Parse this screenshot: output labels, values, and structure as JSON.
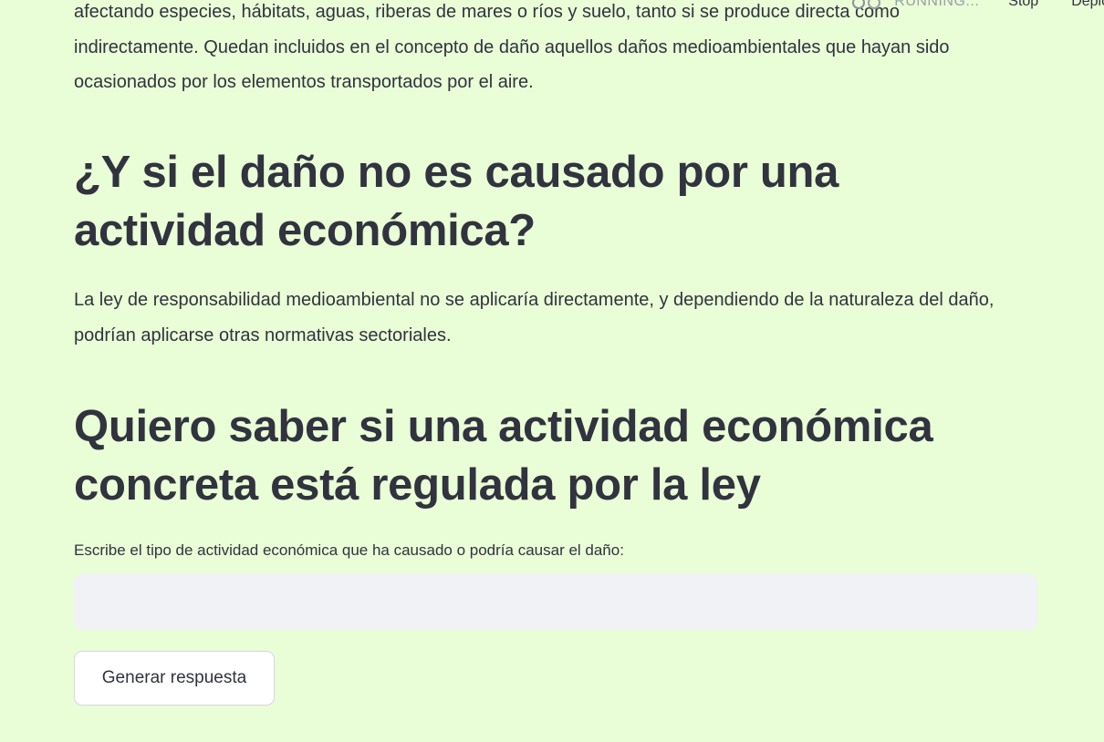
{
  "toolbar": {
    "status_label": "RUNNING...",
    "status_icon": "running-icon",
    "stop_label": "Stop",
    "deploy_label": "Deploy"
  },
  "content": {
    "intro_text": "afectando especies, hábitats, aguas, riberas de mares o ríos y suelo, tanto si se produce directa como indirectamente. Quedan incluidos en el concepto de daño aquellos daños medioambientales que hayan sido ocasionados por los elementos transportados por el aire.",
    "heading_1": "¿Y si el daño no es causado por una actividad económica?",
    "paragraph_1": "La ley de responsabilidad medioambiental no se aplicaría directamente, y dependiendo de la naturaleza del daño, podrían aplicarse otras normativas sectoriales.",
    "heading_2": "Quiero saber si una actividad económica concreta está regulada por la ley",
    "input_label": "Escribe el tipo de actividad económica que ha causado o podría causar el daño:",
    "input_value": "",
    "button_label": "Generar respuesta"
  },
  "colors": {
    "background": "#e9fdd6",
    "text": "#31333f",
    "input_background": "#f0f2f6",
    "button_background": "#ffffff",
    "muted_text": "#9aa0a6"
  }
}
